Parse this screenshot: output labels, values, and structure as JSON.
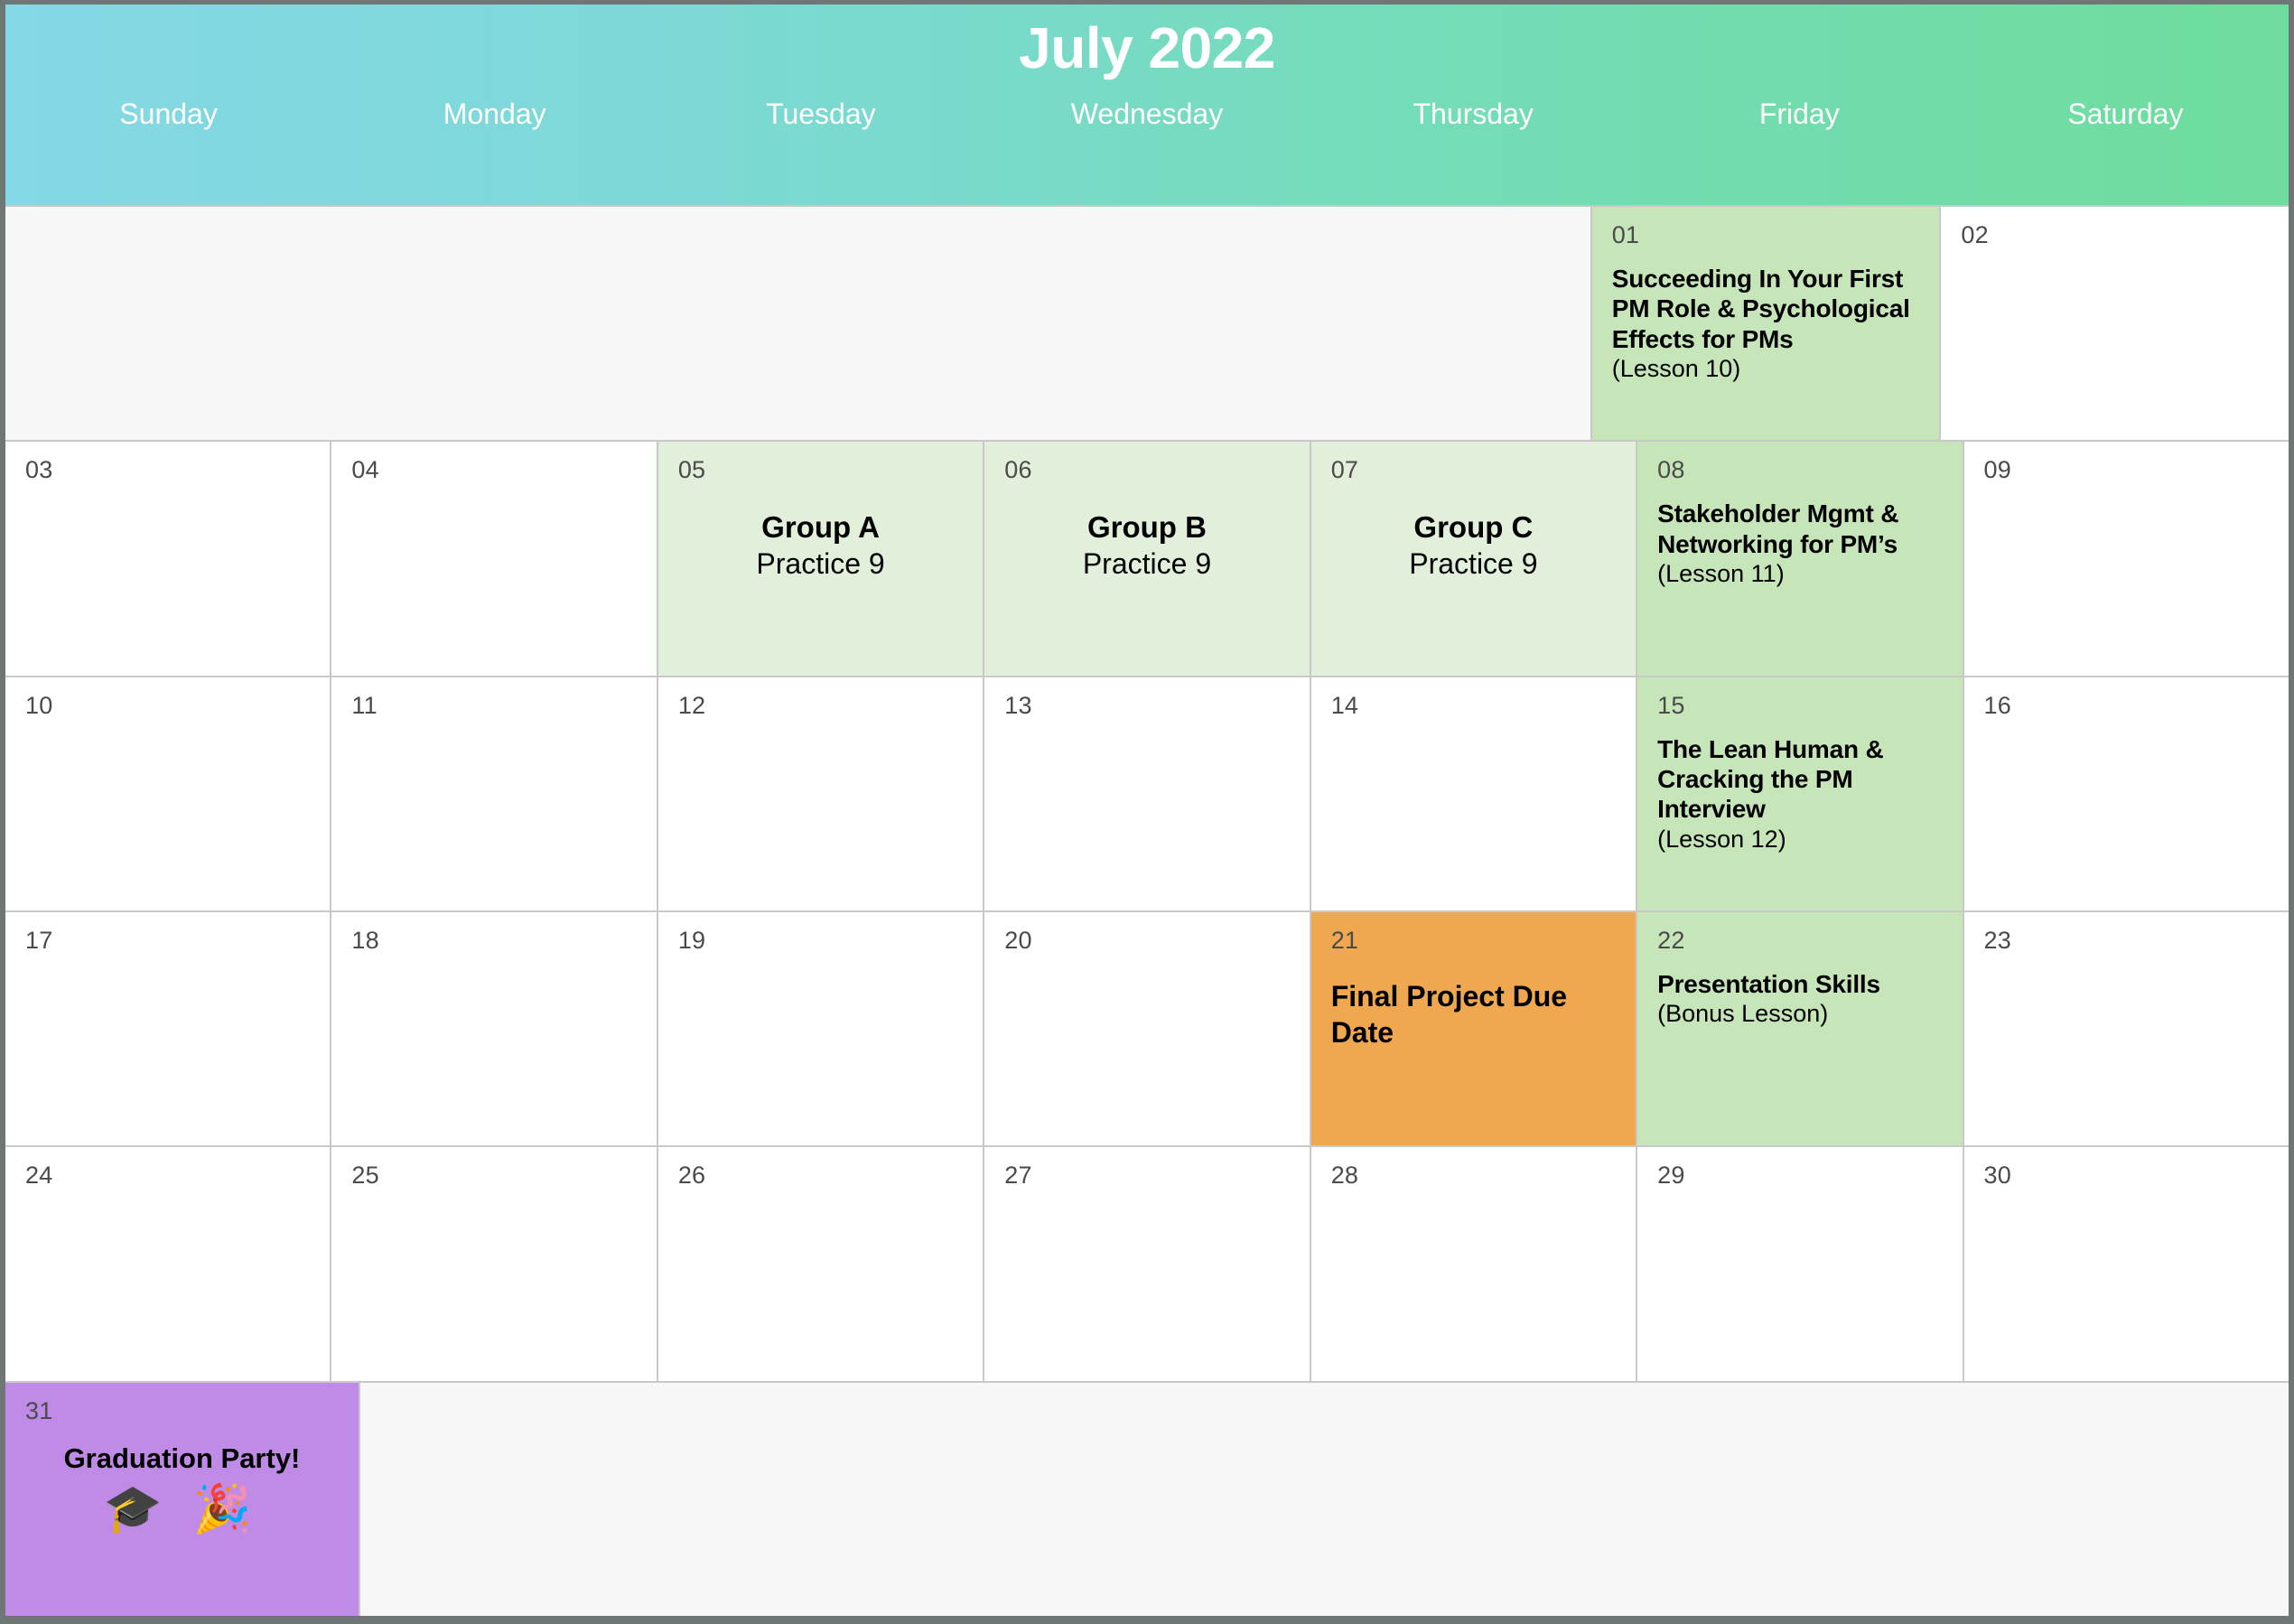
{
  "header": {
    "title": "July 2022",
    "weekdays": [
      "Sunday",
      "Monday",
      "Tuesday",
      "Wednesday",
      "Thursday",
      "Friday",
      "Saturday"
    ],
    "gradient_from": "#85d8e5",
    "gradient_to": "#6edd9d"
  },
  "colors": {
    "lesson_cell": "#c6e5b9",
    "practice_cell": "#e2efdb",
    "due_date_cell": "#efa84f",
    "party_cell": "#c08ae7",
    "blank_cell": "#f7f7f7",
    "grid_line": "#c8c8c8",
    "page_border": "#6e7676",
    "day_number": "#4a4a4a"
  },
  "weeks": [
    {
      "leading_blank_span": 5,
      "days": [
        {
          "num": "01",
          "style": "lesson",
          "title": "Succeeding In Your First PM Role & Psychological Effects for PMs",
          "sub": "(Lesson 10)"
        },
        {
          "num": "02",
          "style": "empty",
          "title": "",
          "sub": ""
        }
      ]
    },
    {
      "leading_blank_span": 0,
      "days": [
        {
          "num": "03",
          "style": "empty",
          "title": "",
          "sub": ""
        },
        {
          "num": "04",
          "style": "empty",
          "title": "",
          "sub": ""
        },
        {
          "num": "05",
          "style": "practice",
          "title": "Group A",
          "sub": "Practice 9"
        },
        {
          "num": "06",
          "style": "practice",
          "title": "Group B",
          "sub": "Practice 9"
        },
        {
          "num": "07",
          "style": "practice",
          "title": "Group C",
          "sub": "Practice 9"
        },
        {
          "num": "08",
          "style": "lesson",
          "title": "Stakeholder Mgmt & Networking for PM’s",
          "sub": "(Lesson 11)"
        },
        {
          "num": "09",
          "style": "empty",
          "title": "",
          "sub": ""
        }
      ]
    },
    {
      "leading_blank_span": 0,
      "days": [
        {
          "num": "10",
          "style": "empty",
          "title": "",
          "sub": ""
        },
        {
          "num": "11",
          "style": "empty",
          "title": "",
          "sub": ""
        },
        {
          "num": "12",
          "style": "empty",
          "title": "",
          "sub": ""
        },
        {
          "num": "13",
          "style": "empty",
          "title": "",
          "sub": ""
        },
        {
          "num": "14",
          "style": "empty",
          "title": "",
          "sub": ""
        },
        {
          "num": "15",
          "style": "lesson",
          "title": "The Lean Human & Cracking the PM Interview",
          "sub": "(Lesson 12)"
        },
        {
          "num": "16",
          "style": "empty",
          "title": "",
          "sub": ""
        }
      ]
    },
    {
      "leading_blank_span": 0,
      "days": [
        {
          "num": "17",
          "style": "empty",
          "title": "",
          "sub": ""
        },
        {
          "num": "18",
          "style": "empty",
          "title": "",
          "sub": ""
        },
        {
          "num": "19",
          "style": "empty",
          "title": "",
          "sub": ""
        },
        {
          "num": "20",
          "style": "empty",
          "title": "",
          "sub": ""
        },
        {
          "num": "21",
          "style": "due",
          "title": "Final Project Due Date",
          "sub": ""
        },
        {
          "num": "22",
          "style": "lesson",
          "title": "Presentation Skills",
          "sub": "(Bonus Lesson)"
        },
        {
          "num": "23",
          "style": "empty",
          "title": "",
          "sub": ""
        }
      ]
    },
    {
      "leading_blank_span": 0,
      "days": [
        {
          "num": "24",
          "style": "empty",
          "title": "",
          "sub": ""
        },
        {
          "num": "25",
          "style": "empty",
          "title": "",
          "sub": ""
        },
        {
          "num": "26",
          "style": "empty",
          "title": "",
          "sub": ""
        },
        {
          "num": "27",
          "style": "empty",
          "title": "",
          "sub": ""
        },
        {
          "num": "28",
          "style": "empty",
          "title": "",
          "sub": ""
        },
        {
          "num": "29",
          "style": "empty",
          "title": "",
          "sub": ""
        },
        {
          "num": "30",
          "style": "empty",
          "title": "",
          "sub": ""
        }
      ]
    },
    {
      "leading_blank_span": 0,
      "trailing_blank_span": 6,
      "days": [
        {
          "num": "31",
          "style": "party",
          "title": "Graduation Party!",
          "sub": "",
          "emoji": "🎓 🎉"
        }
      ]
    }
  ]
}
